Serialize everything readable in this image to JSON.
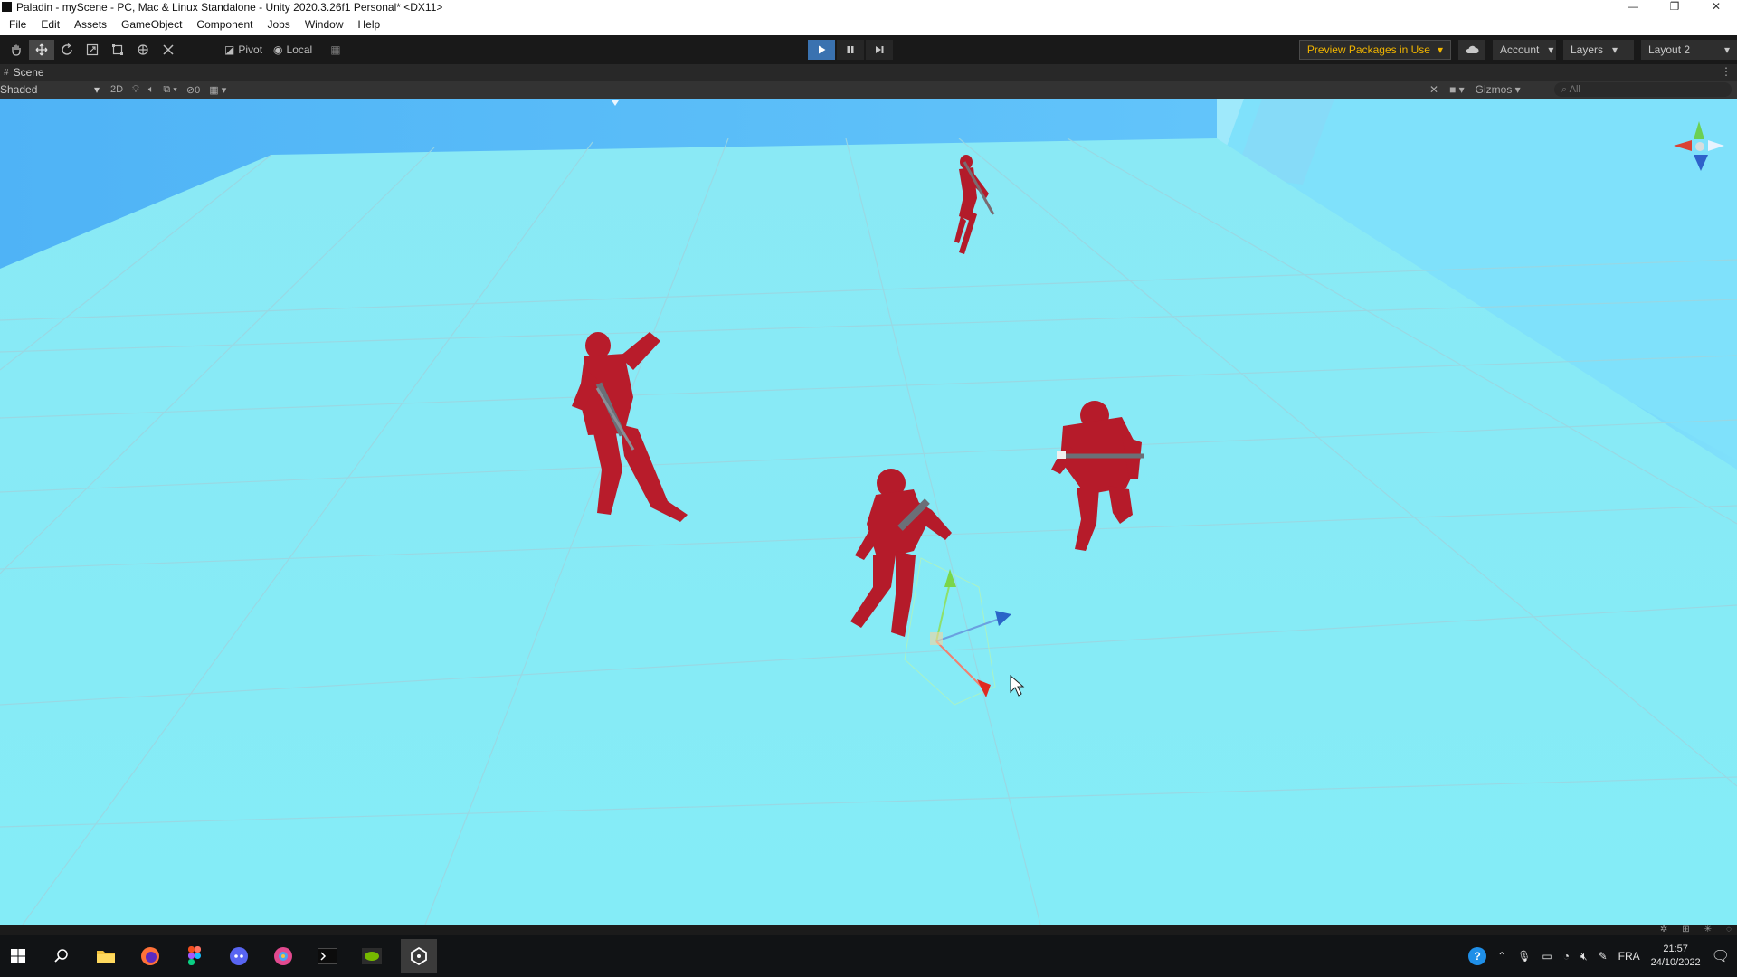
{
  "window": {
    "title": "Paladin - myScene - PC, Mac & Linux Standalone - Unity 2020.3.26f1 Personal* <DX11>",
    "controls": {
      "minimize": "—",
      "restore": "❐",
      "close": "✕"
    }
  },
  "menu": [
    "File",
    "Edit",
    "Assets",
    "GameObject",
    "Component",
    "Jobs",
    "Window",
    "Help"
  ],
  "toolbar": {
    "tools": [
      "hand-tool",
      "move-tool",
      "rotate-tool",
      "scale-tool",
      "rect-tool",
      "transform-tool",
      "custom-tool"
    ],
    "active_tool": "move-tool",
    "pivot_label": "Pivot",
    "local_label": "Local",
    "play_state": "playing",
    "preview_packages_label": "Preview Packages in Use",
    "account_label": "Account",
    "layers_label": "Layers",
    "layout_label": "Layout 2"
  },
  "scene_tab": {
    "label": "Scene"
  },
  "scene_toolbar": {
    "shading_mode": "Shaded",
    "mode_2d_label": "2D",
    "hidden_count": "0",
    "gizmos_label": "Gizmos",
    "search_placeholder": "All"
  },
  "taskbar": {
    "apps": [
      "start",
      "search",
      "file-explorer",
      "firefox",
      "figma",
      "discord",
      "browser",
      "terminal",
      "nvidia",
      "unity"
    ],
    "active_app": "unity",
    "language": "FRA",
    "time": "21:57",
    "date": "24/10/2022"
  },
  "colors": {
    "sky": "#5dbdf8",
    "floor": "#86ebf6",
    "character": "#b81c2b",
    "accent_blue": "#3a72b0",
    "preview_text": "#f0b400"
  }
}
